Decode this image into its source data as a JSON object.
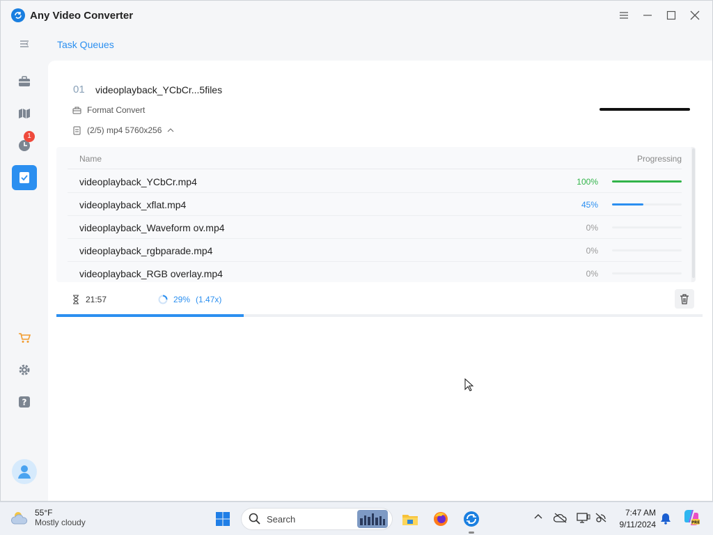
{
  "app": {
    "title": "Any Video Converter",
    "accent_color": "#2b8ff0"
  },
  "window_controls": [
    "menu-icon",
    "minimize-icon",
    "maximize-icon",
    "close-icon"
  ],
  "sidebar": {
    "items": [
      {
        "name": "toolbox",
        "icon": "toolbox-icon"
      },
      {
        "name": "map",
        "icon": "map-icon"
      },
      {
        "name": "history",
        "icon": "clock-icon",
        "badge": "1"
      },
      {
        "name": "task-queues",
        "icon": "task-check-icon",
        "active": true
      },
      {
        "name": "store",
        "icon": "cart-icon"
      },
      {
        "name": "settings",
        "icon": "gear-icon"
      },
      {
        "name": "help",
        "icon": "help-icon"
      }
    ]
  },
  "header": {
    "title": "Task Queues"
  },
  "task": {
    "number": "01",
    "name": "videoplayback_YCbCr...5files",
    "type": "Format Convert",
    "details": "(2/5) mp4 5760x256",
    "elapsed": "21:57",
    "progress_text": "29%",
    "speed": "(1.47x)",
    "progress": 0.29
  },
  "table": {
    "columns": {
      "name": "Name",
      "progress": "Progressing"
    },
    "rows": [
      {
        "file": "videoplayback_YCbCr.mp4",
        "pct": "100%",
        "progress": 1.0,
        "color": "#32b44a"
      },
      {
        "file": "videoplayback_xflat.mp4",
        "pct": "45%",
        "progress": 0.45,
        "color": "#2b8ff0"
      },
      {
        "file": "videoplayback_Waveform ov.mp4",
        "pct": "0%",
        "progress": 0,
        "color": "#999999"
      },
      {
        "file": "videoplayback_rgbparade.mp4",
        "pct": "0%",
        "progress": 0,
        "color": "#999999"
      },
      {
        "file": "videoplayback_RGB overlay.mp4",
        "pct": "0%",
        "progress": 0,
        "color": "#999999"
      }
    ]
  },
  "taskbar": {
    "weather_temp": "55°F",
    "weather_desc": "Mostly cloudy",
    "search_label": "Search",
    "time": "7:47 AM",
    "date": "9/11/2024"
  }
}
